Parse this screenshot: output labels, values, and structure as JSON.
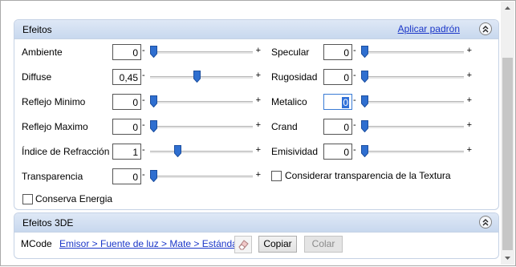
{
  "efeitos": {
    "title": "Efeitos",
    "apply_default_link": "Aplicar padrón",
    "collapse_icon": "chevron-up-double-icon",
    "left_params": [
      {
        "label": "Ambiente",
        "value": "0",
        "level": 0.0
      },
      {
        "label": "Diffuse",
        "value": "0,45",
        "level": 0.45
      },
      {
        "label": "Reflejo Minimo",
        "value": "0",
        "level": 0.0
      },
      {
        "label": "Reflejo Maximo",
        "value": "0",
        "level": 0.0
      },
      {
        "label": "Índice de Refracción",
        "value": "1",
        "level": 0.25
      },
      {
        "label": "Transparencia",
        "value": "0",
        "level": 0.0
      }
    ],
    "right_params": [
      {
        "label": "Specular",
        "value": "0",
        "level": 0.0
      },
      {
        "label": "Rugosidad",
        "value": "0",
        "level": 0.0
      },
      {
        "label": "Metalico",
        "value": "0",
        "level": 0.0
      },
      {
        "label": "Crand",
        "value": "0",
        "level": 0.0
      },
      {
        "label": "Emisividad",
        "value": "0",
        "level": 0.0
      }
    ],
    "slider_minus": "-",
    "slider_plus": "+",
    "texture_transparency_checkbox": {
      "label": "Considerar transparencia de la Textura",
      "checked": false
    },
    "energy_checkbox": {
      "label": "Conserva Energia",
      "checked": false
    }
  },
  "efeitos3de": {
    "title": "Efeitos 3DE",
    "collapse_icon": "chevron-up-double-icon",
    "mcode_label": "MCode",
    "mcode_path": "Emisor > Fuente de luz > Mate > Estándar",
    "eraser_icon": "eraser-icon",
    "copy_button": "Copiar",
    "paste_button": "Colar",
    "paste_disabled": true
  },
  "colors": {
    "header": "#c8d8ee",
    "link": "#1a36c8",
    "thumb": "#2f6fd0"
  }
}
